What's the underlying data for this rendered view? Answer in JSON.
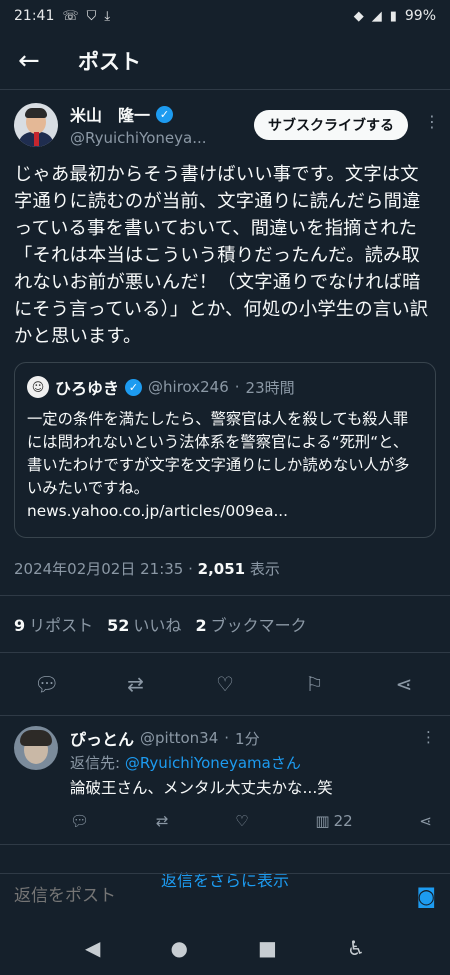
{
  "status": {
    "time": "21:41",
    "battery": "99%"
  },
  "appbar": {
    "title": "ポスト"
  },
  "tweet": {
    "author_name": "米山　隆一",
    "author_handle": "@RyuichiYoneya...",
    "subscribe_label": "サブスクライブする",
    "text": "じゃあ最初からそう書けばいい事です。文字は文字通りに読むのが当前、文字通りに読んだら間違っている事を書いておいて、間違いを指摘された「それは本当はこういう積りだったんだ。読み取れないお前が悪いんだ！（文字通りでなければ暗にそう言っている）」とか、何処の小学生の言い訳かと思います。",
    "quote": {
      "name": "ひろゆき",
      "handle": "@hirox246",
      "time": "23時間",
      "text": "一定の条件を満たしたら、警察官は人を殺しても殺人罪には問われないという法体系を警察官による“死刑“と、書いたわけですが文字を文字通りにしか読めない人が多いみたいですね。",
      "link": "news.yahoo.co.jp/articles/009ea..."
    },
    "timestamp": "2024年02月02日 21:35 · ",
    "views_count": "2,051",
    "views_label": " 表示",
    "reposts_count": "9",
    "reposts_label": "リポスト",
    "likes_count": "52",
    "likes_label": "いいね",
    "bookmarks_count": "2",
    "bookmarks_label": "ブックマーク"
  },
  "reply": {
    "name": "ぴっとん",
    "handle": "@pitton34",
    "time": "1分",
    "reply_to_prefix": "返信先: ",
    "reply_to_mention": "@RyuichiYoneyamaさん",
    "text": "論破王さん、メンタル大丈夫かな...笑",
    "views": "22"
  },
  "more_replies": "返信をさらに表示",
  "composer": {
    "placeholder": "返信をポスト"
  },
  "icons": {
    "back": "arrow-left-icon",
    "verified": "verified-badge-icon",
    "reply": "comment-icon",
    "repost": "repost-icon",
    "like": "heart-icon",
    "bookmark": "bookmark-icon",
    "share": "share-icon",
    "camera": "camera-icon"
  },
  "colors": {
    "background": "#15202b",
    "accent": "#1d9bf0",
    "muted": "#8b98a5"
  }
}
